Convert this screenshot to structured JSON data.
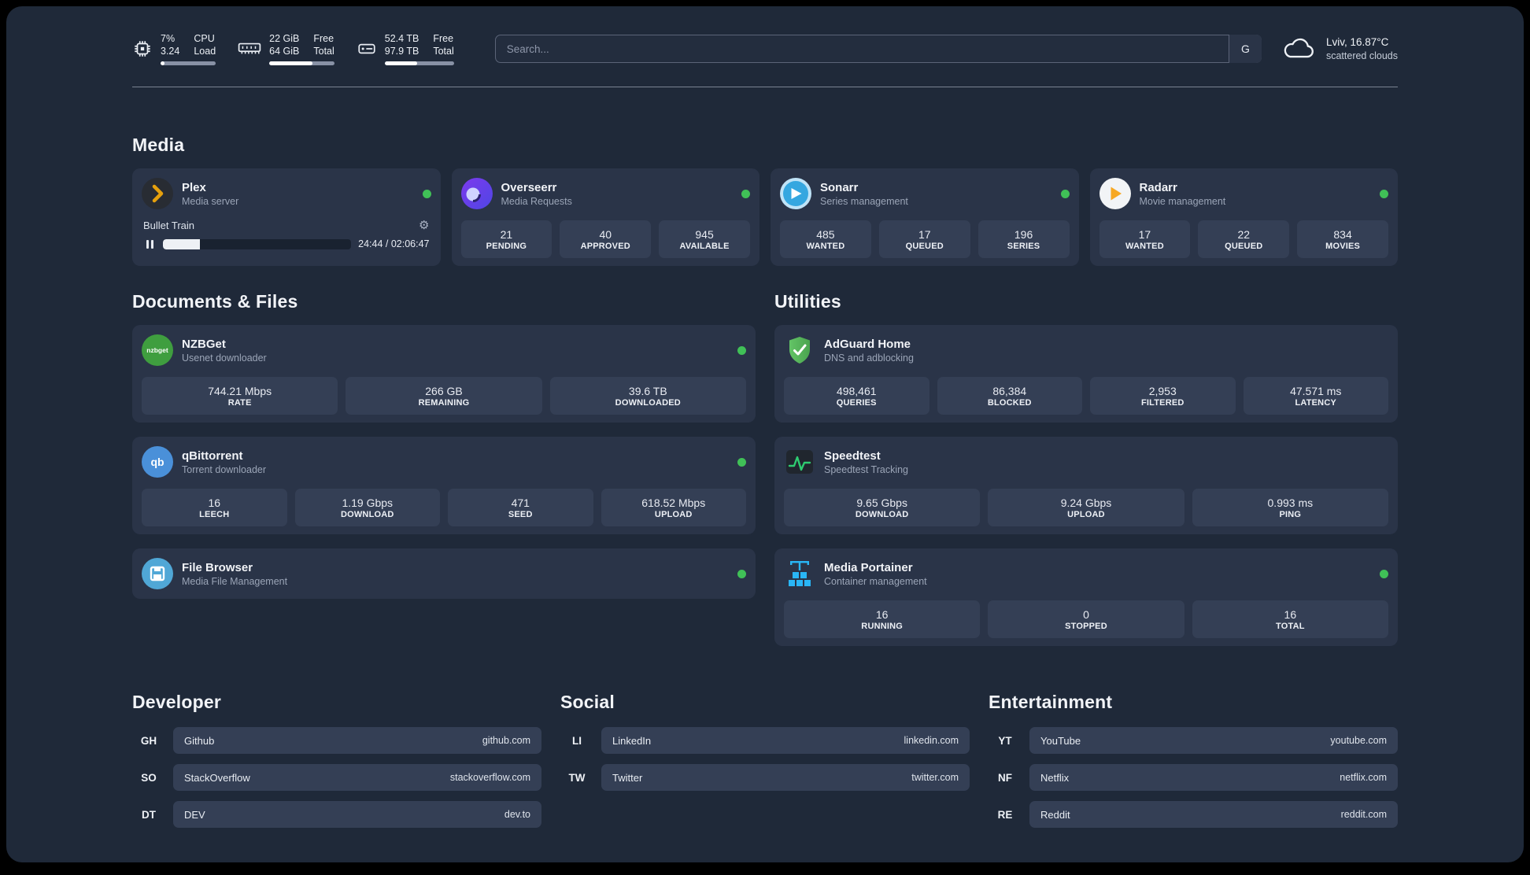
{
  "topbar": {
    "cpu": {
      "value1": "7%",
      "value2": "3.24",
      "label1": "CPU",
      "label2": "Load",
      "bar": 7
    },
    "ram": {
      "value1": "22 GiB",
      "value2": "64 GiB",
      "label1": "Free",
      "label2": "Total",
      "bar": 66
    },
    "disk": {
      "value1": "52.4 TB",
      "value2": "97.9 TB",
      "label1": "Free",
      "label2": "Total",
      "bar": 47
    },
    "search": {
      "placeholder": "Search...",
      "engine_label": "G"
    },
    "weather": {
      "location": "Lviv, 16.87°C",
      "condition": "scattered clouds"
    }
  },
  "media": {
    "heading": "Media",
    "plex": {
      "name": "Plex",
      "subtitle": "Media server",
      "now_playing": "Bullet Train",
      "time": "24:44 / 02:06:47",
      "progress": 19.5
    },
    "overseerr": {
      "name": "Overseerr",
      "subtitle": "Media Requests",
      "stats": [
        {
          "value": "21",
          "label": "PENDING"
        },
        {
          "value": "40",
          "label": "APPROVED"
        },
        {
          "value": "945",
          "label": "AVAILABLE"
        }
      ]
    },
    "sonarr": {
      "name": "Sonarr",
      "subtitle": "Series management",
      "stats": [
        {
          "value": "485",
          "label": "WANTED"
        },
        {
          "value": "17",
          "label": "QUEUED"
        },
        {
          "value": "196",
          "label": "SERIES"
        }
      ]
    },
    "radarr": {
      "name": "Radarr",
      "subtitle": "Movie management",
      "stats": [
        {
          "value": "17",
          "label": "WANTED"
        },
        {
          "value": "22",
          "label": "QUEUED"
        },
        {
          "value": "834",
          "label": "MOVIES"
        }
      ]
    }
  },
  "documents": {
    "heading": "Documents & Files",
    "nzbget": {
      "name": "NZBGet",
      "subtitle": "Usenet downloader",
      "icon_text": "nzbget",
      "stats": [
        {
          "value": "744.21 Mbps",
          "label": "RATE"
        },
        {
          "value": "266 GB",
          "label": "REMAINING"
        },
        {
          "value": "39.6 TB",
          "label": "DOWNLOADED"
        }
      ]
    },
    "qbittorrent": {
      "name": "qBittorrent",
      "subtitle": "Torrent downloader",
      "icon_text": "qb",
      "stats": [
        {
          "value": "16",
          "label": "LEECH"
        },
        {
          "value": "1.19 Gbps",
          "label": "DOWNLOAD"
        },
        {
          "value": "471",
          "label": "SEED"
        },
        {
          "value": "618.52 Mbps",
          "label": "UPLOAD"
        }
      ]
    },
    "filebrowser": {
      "name": "File Browser",
      "subtitle": "Media File Management"
    }
  },
  "utilities": {
    "heading": "Utilities",
    "adguard": {
      "name": "AdGuard Home",
      "subtitle": "DNS and adblocking",
      "stats": [
        {
          "value": "498,461",
          "label": "QUERIES"
        },
        {
          "value": "86,384",
          "label": "BLOCKED"
        },
        {
          "value": "2,953",
          "label": "FILTERED"
        },
        {
          "value": "47.571 ms",
          "label": "LATENCY"
        }
      ]
    },
    "speedtest": {
      "name": "Speedtest",
      "subtitle": "Speedtest Tracking",
      "stats": [
        {
          "value": "9.65 Gbps",
          "label": "DOWNLOAD"
        },
        {
          "value": "9.24 Gbps",
          "label": "UPLOAD"
        },
        {
          "value": "0.993 ms",
          "label": "PING"
        }
      ]
    },
    "portainer": {
      "name": "Media Portainer",
      "subtitle": "Container management",
      "stats": [
        {
          "value": "16",
          "label": "RUNNING"
        },
        {
          "value": "0",
          "label": "STOPPED"
        },
        {
          "value": "16",
          "label": "TOTAL"
        }
      ]
    }
  },
  "bookmarks": {
    "developer": {
      "heading": "Developer",
      "items": [
        {
          "abbr": "GH",
          "name": "Github",
          "domain": "github.com"
        },
        {
          "abbr": "SO",
          "name": "StackOverflow",
          "domain": "stackoverflow.com"
        },
        {
          "abbr": "DT",
          "name": "DEV",
          "domain": "dev.to"
        }
      ]
    },
    "social": {
      "heading": "Social",
      "items": [
        {
          "abbr": "LI",
          "name": "LinkedIn",
          "domain": "linkedin.com"
        },
        {
          "abbr": "TW",
          "name": "Twitter",
          "domain": "twitter.com"
        }
      ]
    },
    "entertainment": {
      "heading": "Entertainment",
      "items": [
        {
          "abbr": "YT",
          "name": "YouTube",
          "domain": "youtube.com"
        },
        {
          "abbr": "NF",
          "name": "Netflix",
          "domain": "netflix.com"
        },
        {
          "abbr": "RE",
          "name": "Reddit",
          "domain": "reddit.com"
        }
      ]
    }
  },
  "icons": {
    "gear": "⚙"
  },
  "colors": {
    "accent_green": "#40c057"
  }
}
